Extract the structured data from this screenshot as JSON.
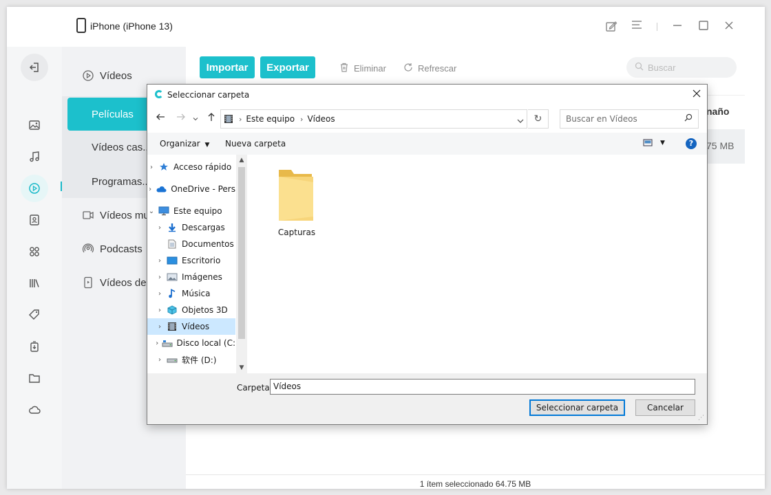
{
  "app": {
    "device_title": "iPhone  (iPhone 13)",
    "titlebar_icons": [
      "edit-icon",
      "menu-icon",
      "minimize-icon",
      "maximize-icon",
      "close-icon"
    ]
  },
  "rail": {
    "icons": [
      "back-icon",
      "photos-icon",
      "music-icon",
      "videos-icon",
      "contacts-icon",
      "apps-icon",
      "books-icon",
      "ringtones-icon",
      "backup-icon",
      "files-icon",
      "cloud-icon"
    ],
    "active": "videos-icon"
  },
  "sidebar": {
    "items": [
      {
        "label": "Vídeos",
        "icon": "play-circle-icon"
      },
      {
        "label": "Películas",
        "active": true
      },
      {
        "label": "Vídeos cas..."
      },
      {
        "label": "Programas..."
      },
      {
        "label": "Vídeos mu",
        "icon": "music-video-icon"
      },
      {
        "label": "Podcasts",
        "icon": "podcast-icon"
      },
      {
        "label": "Vídeos de...",
        "icon": "phone-video-icon"
      }
    ]
  },
  "toolbar": {
    "import_label": "Importar",
    "export_label": "Exportar",
    "delete_label": "Eliminar",
    "refresh_label": "Refrescar",
    "search_placeholder": "Buscar"
  },
  "table": {
    "column_size": "naño",
    "row_size": "75 MB"
  },
  "status": {
    "text": "1 ítem seleccionado 64.75 MB"
  },
  "dialog": {
    "title": "Seleccionar carpeta",
    "breadcrumb": [
      "Este equipo",
      "Vídeos"
    ],
    "search_placeholder": "Buscar en Vídeos",
    "organize_label": "Organizar",
    "new_folder_label": "Nueva carpeta",
    "tree": [
      {
        "label": "Acceso rápido",
        "icon": "star-icon",
        "indent": 0
      },
      {
        "label": "OneDrive - Pers",
        "icon": "onedrive-cloud-icon",
        "indent": 0
      },
      {
        "label": "Este equipo",
        "icon": "computer-icon",
        "indent": 0,
        "expanded": true
      },
      {
        "label": "Descargas",
        "icon": "download-folder-icon",
        "indent": 1
      },
      {
        "label": "Documentos",
        "icon": "documents-folder-icon",
        "indent": 1
      },
      {
        "label": "Escritorio",
        "icon": "desktop-folder-icon",
        "indent": 1
      },
      {
        "label": "Imágenes",
        "icon": "pictures-folder-icon",
        "indent": 1
      },
      {
        "label": "Música",
        "icon": "music-note-icon",
        "indent": 1
      },
      {
        "label": "Objetos 3D",
        "icon": "3d-objects-icon",
        "indent": 1
      },
      {
        "label": "Vídeos",
        "icon": "videos-folder-icon",
        "indent": 1,
        "selected": true
      },
      {
        "label": "Disco local (C:",
        "icon": "drive-c-icon",
        "indent": 1
      },
      {
        "label": "软件 (D:)",
        "icon": "drive-d-icon",
        "indent": 1
      }
    ],
    "files": [
      {
        "label": "Capturas",
        "icon": "folder-icon"
      }
    ],
    "folder_field_label": "Carpeta:",
    "folder_field_value": "Vídeos",
    "select_button": "Seleccionar carpeta",
    "cancel_button": "Cancelar"
  }
}
